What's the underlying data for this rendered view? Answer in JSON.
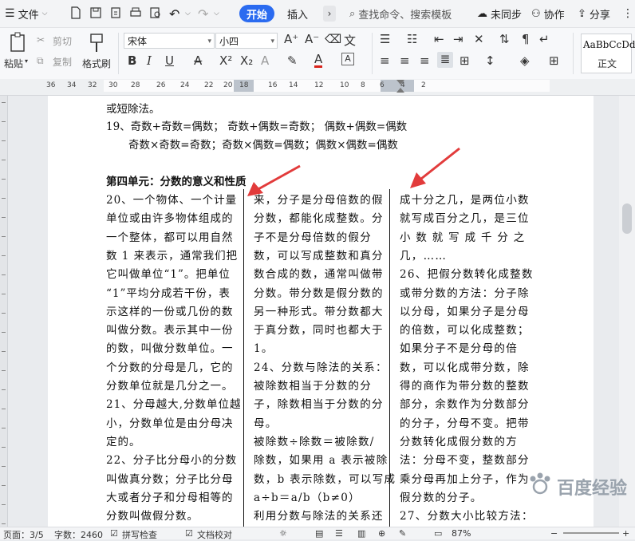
{
  "topbar": {
    "file_label": "文件",
    "tab_start": "开始",
    "tab_insert": "插入",
    "search_placeholder": "查找命令、搜索模板",
    "sync_label": "未同步",
    "collab_label": "协作",
    "share_label": "分享"
  },
  "ribbon": {
    "paste": "粘贴",
    "cut": "剪切",
    "copy": "复制",
    "format_painter": "格式刷",
    "font_name": "宋体",
    "font_size": "小四",
    "style_preview": "AaBbCcDd",
    "style_name": "正文"
  },
  "ruler": {
    "labels": [
      "36",
      "34",
      "32",
      "30",
      "28",
      "26",
      "24",
      "22",
      "20",
      "18",
      "16",
      "14",
      "12",
      "10",
      "8",
      "6",
      "4",
      "2"
    ]
  },
  "document": {
    "lines_top": [
      "或短除法。",
      "19、奇数+奇数=偶数； 奇数+偶数=奇数； 偶数+偶数=偶数",
      "奇数×奇数=奇数；奇数×偶数=偶数；偶数×偶数=偶数"
    ],
    "heading": "第四单元：分数的意义和性质",
    "col1": [
      "20、一个物体、一个计量",
      "单位或由许多物体组成的",
      "一个整体，都可以用自然",
      "数 1 来表示，通常我们把",
      "它叫做单位“1”。把单位",
      "“1”平均分成若干份，表",
      "示这样的一份或几份的数",
      "叫做分数。表示其中一份",
      "的数，叫做分数单位。一",
      "个分数的分母是几，它的",
      "分数单位就是几分之一。",
      "21、分母越大,分数单位越",
      "小，分数单位是由分母决",
      "定的。",
      "22、分子比分母小的分数",
      "叫做真分数；分子比分母",
      "大或者分子和分母相等的",
      "分数叫做假分数。"
    ],
    "col2": [
      "来，分子是分母倍数的假",
      "分数，都能化成整数。分",
      "子不是分母倍数的假分",
      "数，可以写成整数和真分",
      "数合成的数，通常叫做带",
      "分数。带分数是假分数的",
      "另一种形式。带分数都大",
      "于真分数，同时也都大于",
      "1。",
      "24、分数与除法的关系：",
      "被除数相当于分数的分",
      "子，除数相当于分数的分",
      "母。",
      "被除数÷除数＝被除数/",
      "除数，如果用 a 表示被除",
      "数，b 表示除数，可以写成",
      "a÷b＝a/b（b≠0）",
      "利用分数与除法的关系还"
    ],
    "col3": [
      "成十分之几，是两位小数",
      "就写成百分之几，是三位",
      "小 数 就 写 成 千 分 之",
      "几，……",
      "26、把假分数转化成整数",
      "或带分数的方法：分子除",
      "以分母，如果分子是分母",
      "的倍数，可以化成整数；",
      "如果分子不是分母的倍",
      "数，可以化成带分数，除",
      "得的商作为带分数的整数",
      "部分，余数作为分数部分",
      "的分子，分母不变。把带",
      "分数转化成假分数的方",
      "法：分母不变，整数部分",
      "乘分母再加上分子，作为",
      "假分数的分子。",
      "27、分数大小比较方法："
    ]
  },
  "watermark": {
    "text": "百度经验"
  },
  "status": {
    "page": "页面：3/5",
    "words": "字数：2460",
    "spell": "拼写检查",
    "proof": "文档校对",
    "zoom": "87%"
  },
  "colors": {
    "accent": "#2b6bf0",
    "arrow": "#e23b3b"
  }
}
